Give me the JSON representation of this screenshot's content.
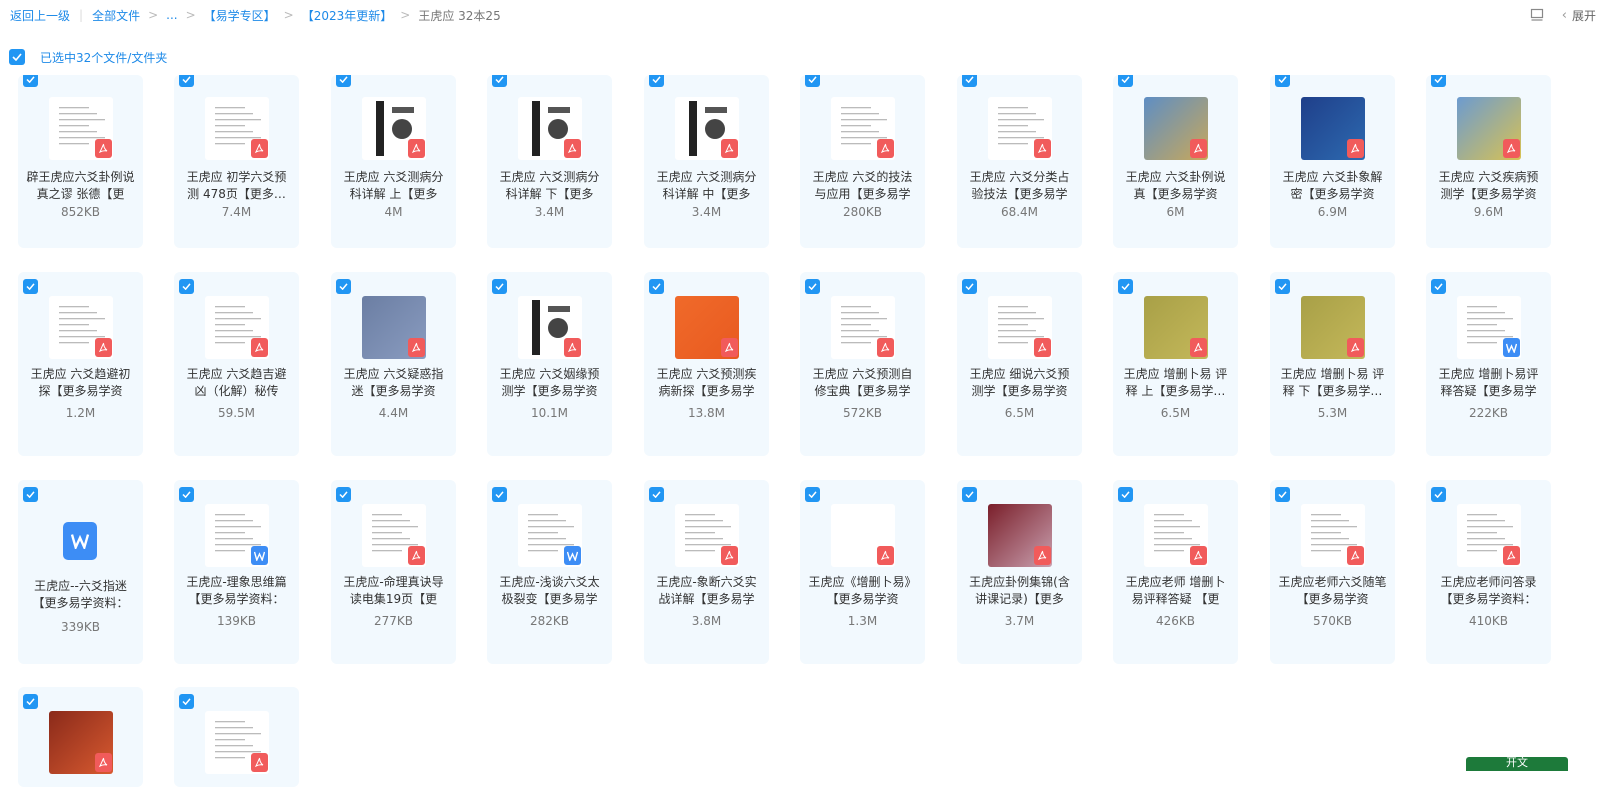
{
  "breadcrumb": {
    "back": "返回上一级",
    "all_files": "全部文件",
    "ellipsis": "...",
    "crumb1": "【易学专区】",
    "crumb2": "【2023年更新】",
    "current": "王虎应 32本25"
  },
  "toolbar": {
    "expand_label": "展开",
    "view_icon": "list-view-icon",
    "chevron_icon": "chevron-left-icon"
  },
  "selection": {
    "text": "已选中32个文件/文件夹",
    "checked": true
  },
  "colors": {
    "accent": "#2196f3",
    "link": "#1e8ae8",
    "card_bg": "#f2f9fe",
    "pdf_badge": "#f15b5b",
    "word_badge": "#3d8df5"
  },
  "files": [
    {
      "name": "辟王虎应六爻卦例说真之谬 张德【更",
      "size": "852KB",
      "type": "pdf",
      "thumb": "doc"
    },
    {
      "name": "王虎应 初学六爻预测 478页【更多…",
      "size": "7.4M",
      "type": "pdf",
      "thumb": "doc"
    },
    {
      "name": "王虎应 六爻测病分科详解 上【更多",
      "size": "4M",
      "type": "pdf",
      "thumb": "scan"
    },
    {
      "name": "王虎应 六爻测病分科详解 下【更多",
      "size": "3.4M",
      "type": "pdf",
      "thumb": "scan"
    },
    {
      "name": "王虎应 六爻测病分科详解 中【更多",
      "size": "3.4M",
      "type": "pdf",
      "thumb": "scan"
    },
    {
      "name": "王虎应 六爻的技法与应用【更多易学",
      "size": "280KB",
      "type": "pdf",
      "thumb": "doc"
    },
    {
      "name": "王虎应 六爻分类占验技法【更多易学",
      "size": "68.4M",
      "type": "pdf",
      "thumb": "doc"
    },
    {
      "name": "王虎应 六爻卦例说真【更多易学资",
      "size": "6M",
      "type": "pdf",
      "thumb": "cover-blue"
    },
    {
      "name": "王虎应 六爻卦象解密【更多易学资",
      "size": "6.9M",
      "type": "pdf",
      "thumb": "cover-navy"
    },
    {
      "name": "王虎应 六爻疾病预测学【更多易学资",
      "size": "9.6M",
      "type": "pdf",
      "thumb": "cover-multi"
    },
    {
      "name": "王虎应 六爻趋避初探【更多易学资",
      "size": "1.2M",
      "type": "pdf",
      "thumb": "doc"
    },
    {
      "name": "王虎应 六爻趋吉避凶（化解）秘传",
      "size": "59.5M",
      "type": "pdf",
      "thumb": "doc"
    },
    {
      "name": "王虎应 六爻疑惑指迷【更多易学资",
      "size": "4.4M",
      "type": "pdf",
      "thumb": "cover-slate"
    },
    {
      "name": "王虎应 六爻姻缘预测学【更多易学资",
      "size": "10.1M",
      "type": "pdf",
      "thumb": "scan"
    },
    {
      "name": "王虎应 六爻预测疾病新探【更多易学",
      "size": "13.8M",
      "type": "pdf",
      "thumb": "cover-orange"
    },
    {
      "name": "王虎应 六爻预测自修宝典【更多易学",
      "size": "572KB",
      "type": "pdf",
      "thumb": "doc"
    },
    {
      "name": "王虎应 细说六爻预测学【更多易学资",
      "size": "6.5M",
      "type": "pdf",
      "thumb": "doc"
    },
    {
      "name": "王虎应 增删卜易 评释 上【更多易学…",
      "size": "6.5M",
      "type": "pdf",
      "thumb": "cover-olive"
    },
    {
      "name": "王虎应 增删卜易 评释 下【更多易学…",
      "size": "5.3M",
      "type": "pdf",
      "thumb": "cover-olive"
    },
    {
      "name": "王虎应 增删卜易评释答疑【更多易学",
      "size": "222KB",
      "type": "word",
      "thumb": "doc"
    },
    {
      "name": "王虎应--六爻指迷【更多易学资料：",
      "size": "339KB",
      "type": "word",
      "thumb": "bigword"
    },
    {
      "name": "王虎应-理象思维篇【更多易学资料：",
      "size": "139KB",
      "type": "word",
      "thumb": "doc"
    },
    {
      "name": "王虎应-命理真诀导读电集19页【更",
      "size": "277KB",
      "type": "pdf",
      "thumb": "doc"
    },
    {
      "name": "王虎应-浅谈六爻太极裂变【更多易学",
      "size": "282KB",
      "type": "word",
      "thumb": "doc"
    },
    {
      "name": "王虎应-象断六爻实战详解【更多易学",
      "size": "3.8M",
      "type": "pdf",
      "thumb": "doc"
    },
    {
      "name": "王虎应《增删卜易》【更多易学资",
      "size": "1.3M",
      "type": "pdf",
      "thumb": "blank"
    },
    {
      "name": "王虎应卦例集锦(含讲课记录)【更多",
      "size": "3.7M",
      "type": "pdf",
      "thumb": "cover-maroon"
    },
    {
      "name": "王虎应老师 增删卜易评释答疑 【更",
      "size": "426KB",
      "type": "pdf",
      "thumb": "doc"
    },
    {
      "name": "王虎应老师六爻随笔【更多易学资",
      "size": "570KB",
      "type": "pdf",
      "thumb": "doc"
    },
    {
      "name": "王虎应老师问答录【更多易学资料：",
      "size": "410KB",
      "type": "pdf",
      "thumb": "doc"
    },
    {
      "name": "",
      "size": "",
      "type": "pdf",
      "thumb": "cover-red"
    },
    {
      "name": "",
      "size": "",
      "type": "pdf",
      "thumb": "doc"
    }
  ],
  "footer_button": "开文"
}
